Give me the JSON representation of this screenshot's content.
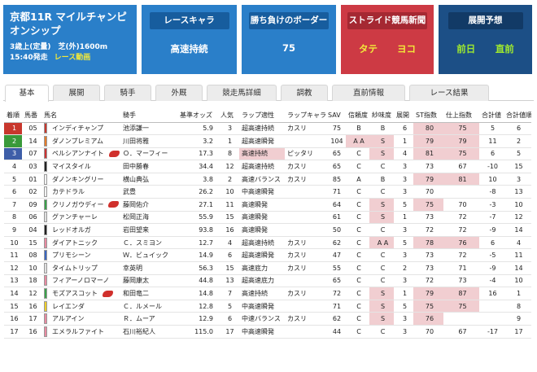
{
  "race": {
    "title": "京都11R マイルチャンピオンシップ",
    "conditions": "3歳上(定量)　芝(外)1600m",
    "start_time": "15:40発走",
    "video_link": "レース動画"
  },
  "cards": {
    "chara": {
      "heading": "レースキャラ",
      "value": "高速持続"
    },
    "border": {
      "heading": "勝ち負けのボーダー",
      "value": "75"
    },
    "stride": {
      "heading": "ストライド競馬新聞",
      "left": "タテ",
      "right": "ヨコ"
    },
    "prediction": {
      "heading": "展開予想",
      "left": "前日",
      "right": "直前"
    }
  },
  "colors": {
    "card_blue": "#2a7fc9",
    "card_red": "#cd3a44",
    "card_navy": "#1c4f86",
    "highlight": "#f1ced1",
    "rank1": "#c8372d",
    "rank2": "#3a9a3a",
    "rank3": "#3e5ea8"
  },
  "tabs": [
    "基本",
    "展開",
    "騎手",
    "外厩",
    "競走馬詳細",
    "調教",
    "直前情報",
    "レース結果"
  ],
  "table": {
    "headers": [
      "着順",
      "馬番",
      "馬名",
      "騎手",
      "基準オッズ",
      "人気",
      "ラップ適性",
      "ラップキャラ",
      "SAV",
      "信頼度",
      "紗味度",
      "展開",
      "ST指数",
      "仕上指数",
      "合計値",
      "合計値順位"
    ],
    "rows": [
      {
        "rank": "1",
        "no": "05",
        "gate": "#c8372d",
        "name": "インディチャンプ",
        "icon": false,
        "jockey": "池添謙一",
        "odds": "5.9",
        "pop": "3",
        "lap": "超高速持続",
        "chara": "カスリ",
        "sav": "75",
        "trust": "B",
        "sami": "B",
        "dev": "6",
        "st": "80",
        "fin": "75",
        "total": "5",
        "order": "6",
        "hl": [
          "st",
          "fin"
        ]
      },
      {
        "rank": "2",
        "no": "14",
        "gate": "#e47c2a",
        "name": "ダノンプレミアム",
        "icon": false,
        "jockey": "川田将雅",
        "odds": "3.2",
        "pop": "1",
        "lap": "超高速瞬発",
        "chara": "",
        "sav": "104",
        "trust": "A A",
        "sami": "S",
        "dev": "1",
        "st": "79",
        "fin": "79",
        "total": "11",
        "order": "2",
        "hl": [
          "trust",
          "sami",
          "st",
          "fin"
        ]
      },
      {
        "rank": "3",
        "no": "07",
        "gate": "#cc3333",
        "name": "ペルシアンナイト",
        "icon": true,
        "jockey": "Ｏ．マーフィー",
        "odds": "17.3",
        "pop": "8",
        "lap": "高速持続",
        "chara": "ピッタリ",
        "sav": "65",
        "trust": "C",
        "sami": "S",
        "dev": "4",
        "st": "81",
        "fin": "75",
        "total": "6",
        "order": "5",
        "hl": [
          "lap",
          "sami",
          "st",
          "fin"
        ]
      },
      {
        "rank": "4",
        "no": "03",
        "gate": "#222222",
        "name": "マイスタイル",
        "icon": false,
        "jockey": "田中勝春",
        "odds": "34.4",
        "pop": "12",
        "lap": "超高速持続",
        "chara": "カスリ",
        "sav": "65",
        "trust": "C",
        "sami": "C",
        "dev": "3",
        "st": "73",
        "fin": "67",
        "total": "-10",
        "order": "15",
        "hl": []
      },
      {
        "rank": "5",
        "no": "01",
        "gate": "#f2f2f2",
        "name": "ダノンキングリー",
        "icon": false,
        "jockey": "横山典弘",
        "odds": "3.8",
        "pop": "2",
        "lap": "高速バランス",
        "chara": "カスリ",
        "sav": "85",
        "trust": "A",
        "sami": "B",
        "dev": "3",
        "st": "79",
        "fin": "81",
        "total": "10",
        "order": "3",
        "hl": [
          "st",
          "fin"
        ]
      },
      {
        "rank": "6",
        "no": "02",
        "gate": "#f2f2f2",
        "name": "カテドラル",
        "icon": false,
        "jockey": "武豊",
        "odds": "26.2",
        "pop": "10",
        "lap": "中高速瞬発",
        "chara": "",
        "sav": "71",
        "trust": "C",
        "sami": "C",
        "dev": "3",
        "st": "70",
        "fin": "",
        "total": "-8",
        "order": "13",
        "hl": []
      },
      {
        "rank": "7",
        "no": "09",
        "gate": "#3aa04a",
        "name": "クリノガウディー",
        "icon": true,
        "jockey": "藤岡佑介",
        "odds": "27.1",
        "pop": "11",
        "lap": "高速瞬発",
        "chara": "",
        "sav": "64",
        "trust": "C",
        "sami": "S",
        "dev": "5",
        "st": "75",
        "fin": "70",
        "total": "-3",
        "order": "10",
        "hl": [
          "sami",
          "st"
        ]
      },
      {
        "rank": "8",
        "no": "06",
        "gate": "#e0e0e0",
        "name": "グァンチャーレ",
        "icon": false,
        "jockey": "松岡正海",
        "odds": "55.9",
        "pop": "15",
        "lap": "高速瞬発",
        "chara": "",
        "sav": "61",
        "trust": "C",
        "sami": "S",
        "dev": "1",
        "st": "73",
        "fin": "72",
        "total": "-7",
        "order": "12",
        "hl": [
          "sami"
        ]
      },
      {
        "rank": "9",
        "no": "04",
        "gate": "#222222",
        "name": "レッドオルガ",
        "icon": false,
        "jockey": "岩田望来",
        "odds": "93.8",
        "pop": "16",
        "lap": "高速瞬発",
        "chara": "",
        "sav": "50",
        "trust": "C",
        "sami": "C",
        "dev": "3",
        "st": "72",
        "fin": "72",
        "total": "-9",
        "order": "14",
        "hl": []
      },
      {
        "rank": "10",
        "no": "15",
        "gate": "#e88aa0",
        "name": "ダイアトニック",
        "icon": false,
        "jockey": "Ｃ．スミヨン",
        "odds": "12.7",
        "pop": "4",
        "lap": "超高速持続",
        "chara": "カスリ",
        "sav": "62",
        "trust": "C",
        "sami": "A A",
        "dev": "5",
        "st": "78",
        "fin": "76",
        "total": "6",
        "order": "4",
        "hl": [
          "sami",
          "st",
          "fin"
        ]
      },
      {
        "rank": "11",
        "no": "08",
        "gate": "#3a66c0",
        "name": "プリモシーン",
        "icon": false,
        "jockey": "Ｗ．ビュイック",
        "odds": "14.9",
        "pop": "6",
        "lap": "超高速瞬発",
        "chara": "カスリ",
        "sav": "47",
        "trust": "C",
        "sami": "C",
        "dev": "3",
        "st": "73",
        "fin": "72",
        "total": "-5",
        "order": "11",
        "hl": []
      },
      {
        "rank": "12",
        "no": "10",
        "gate": "#e0e0e0",
        "name": "タイムトリップ",
        "icon": false,
        "jockey": "幸英明",
        "odds": "56.3",
        "pop": "15",
        "lap": "高速底力",
        "chara": "カスリ",
        "sav": "55",
        "trust": "C",
        "sami": "C",
        "dev": "2",
        "st": "73",
        "fin": "71",
        "total": "-9",
        "order": "14",
        "hl": []
      },
      {
        "rank": "13",
        "no": "18",
        "gate": "#e88aa0",
        "name": "フィアーノロマーノ",
        "icon": false,
        "jockey": "藤岡康太",
        "odds": "44.8",
        "pop": "13",
        "lap": "超高速底力",
        "chara": "",
        "sav": "65",
        "trust": "C",
        "sami": "C",
        "dev": "3",
        "st": "72",
        "fin": "73",
        "total": "-4",
        "order": "10",
        "hl": []
      },
      {
        "rank": "14",
        "no": "12",
        "gate": "#3aa04a",
        "name": "モズアスコット",
        "icon": true,
        "jockey": "和田竜二",
        "odds": "14.8",
        "pop": "7",
        "lap": "高速持続",
        "chara": "カスリ",
        "sav": "72",
        "trust": "C",
        "sami": "S",
        "dev": "1",
        "st": "79",
        "fin": "87",
        "total": "16",
        "order": "1",
        "hl": [
          "sami",
          "st",
          "fin"
        ]
      },
      {
        "rank": "15",
        "no": "16",
        "gate": "#f0cf2a",
        "name": "レイエンダ",
        "icon": false,
        "jockey": "Ｃ．ルメール",
        "odds": "12.8",
        "pop": "5",
        "lap": "中高速瞬発",
        "chara": "",
        "sav": "71",
        "trust": "C",
        "sami": "S",
        "dev": "5",
        "st": "75",
        "fin": "75",
        "total": "",
        "order": "8",
        "hl": [
          "sami",
          "st",
          "fin"
        ]
      },
      {
        "rank": "16",
        "no": "17",
        "gate": "#e88aa0",
        "name": "アルアイン",
        "icon": false,
        "jockey": "Ｒ．ムーア",
        "odds": "12.9",
        "pop": "6",
        "lap": "中速バランス",
        "chara": "カスリ",
        "sav": "62",
        "trust": "C",
        "sami": "S",
        "dev": "3",
        "st": "76",
        "fin": "",
        "total": "",
        "order": "9",
        "hl": [
          "sami",
          "st"
        ]
      },
      {
        "rank": "17",
        "no": "16",
        "gate": "#e88aa0",
        "name": "エメラルファイト",
        "icon": false,
        "jockey": "石川裕紀人",
        "odds": "115.0",
        "pop": "17",
        "lap": "中高速瞬発",
        "chara": "",
        "sav": "44",
        "trust": "C",
        "sami": "C",
        "dev": "3",
        "st": "70",
        "fin": "67",
        "total": "-17",
        "order": "17",
        "hl": []
      }
    ]
  }
}
